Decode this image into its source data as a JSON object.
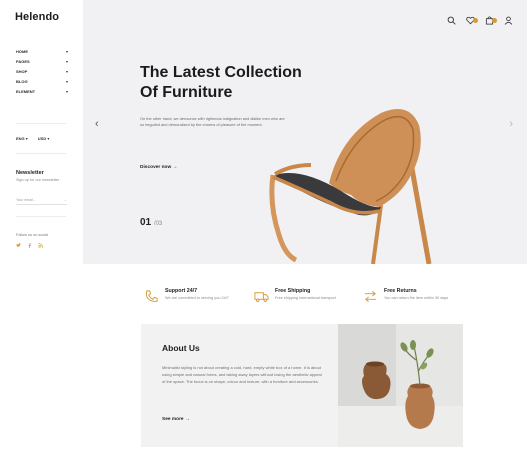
{
  "brand": {
    "logo": "Helendo",
    "accent": "#d49a36"
  },
  "sidebar": {
    "nav": [
      {
        "label": "HOME",
        "caret": "▾"
      },
      {
        "label": "PAGES",
        "caret": "▾"
      },
      {
        "label": "SHOP",
        "caret": "▾"
      },
      {
        "label": "BLOG",
        "caret": "▾"
      },
      {
        "label": "ELEMENT",
        "caret": "▾"
      }
    ],
    "language": "ENG",
    "currency": "USD",
    "newsletter": {
      "title": "Newsletter",
      "subtitle": "Sign up for our newsletter",
      "placeholder": "Your email..."
    },
    "follow": "Follow us on social",
    "social_icons": [
      "twitter-icon",
      "facebook-icon",
      "rss-icon"
    ]
  },
  "header": {
    "icons": [
      "search-icon",
      "wishlist-icon",
      "cart-icon",
      "account-icon"
    ]
  },
  "hero": {
    "title_line1": "The Latest Collection",
    "title_line2": "Of Furniture",
    "description": "On the other hand, we denounce with righteous indignation and dislike men who are so beguiled and demoralized by the charms of pleasure of the moment.",
    "cta": "Discover now",
    "slide_current": "01",
    "slide_total": "/03"
  },
  "features": [
    {
      "title": "Support 24/7",
      "subtitle": "We are committed to serving you 24/7",
      "icon": "phone-icon"
    },
    {
      "title": "Free Shipping",
      "subtitle": "Free shipping international transport",
      "icon": "truck-icon"
    },
    {
      "title": "Free Returns",
      "subtitle": "You can return the item within 30 days",
      "icon": "return-arrows-icon"
    }
  ],
  "about": {
    "title": "About Us",
    "text": "Minimalist styling is not about creating a cold, hard, empty white box of a home. It is about using simple and natural forms, and taking away layers without losing the aesthetic appeal of the space. The focus is on shape, colour and texture, with a furniture and accessories.",
    "cta": "See more"
  }
}
